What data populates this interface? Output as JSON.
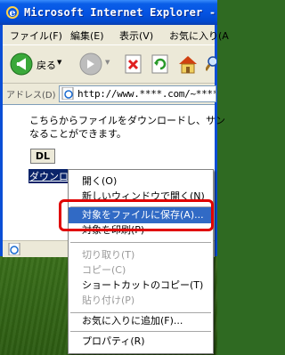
{
  "window": {
    "title": "Microsoft Internet Explorer -"
  },
  "menubar": [
    "ファイル(F)",
    "編集(E)",
    "表示(V)",
    "お気に入り(A"
  ],
  "toolbar": {
    "back_label": "戻る"
  },
  "address": {
    "label": "アドレス(D)",
    "url": "http://www.****.com/~*****/"
  },
  "content": {
    "text_line1": "こちらからファイルをダウンロードし、サン",
    "text_line2": "なることができます。",
    "dl_button": "DL",
    "download_link": "ダウンロード"
  },
  "context_menu": {
    "items": [
      {
        "label": "開く(O)"
      },
      {
        "label": "新しいウィンドウで開く(N)"
      },
      {
        "label": "対象をファイルに保存(A)..."
      },
      {
        "label": "対象を印刷(P)"
      },
      {
        "label": "切り取り(T)"
      },
      {
        "label": "コピー(C)"
      },
      {
        "label": "ショートカットのコピー(T)"
      },
      {
        "label": "貼り付け(P)"
      },
      {
        "label": "お気に入りに追加(F)..."
      },
      {
        "label": "プロパティ(R)"
      }
    ]
  }
}
